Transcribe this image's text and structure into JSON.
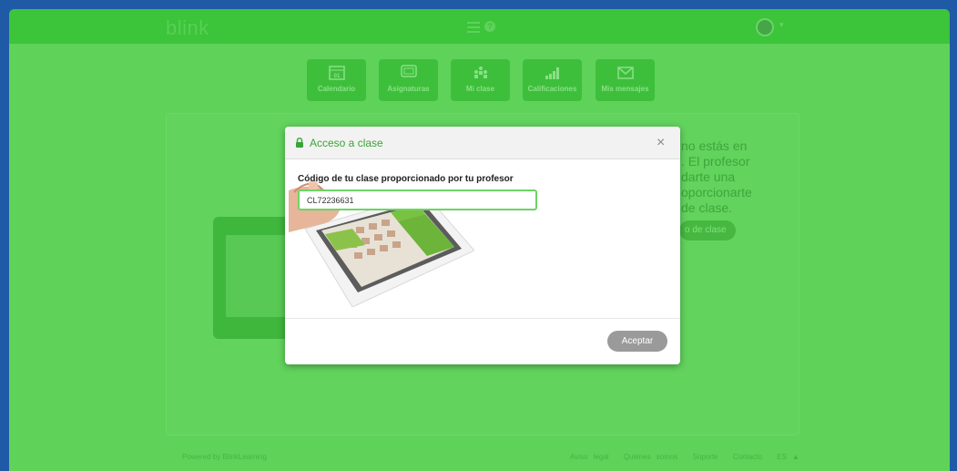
{
  "header": {
    "logo": "blink",
    "menu_icon": "hamburger-icon",
    "help_icon": "question-icon",
    "help_glyph": "?",
    "account_caret": "▾"
  },
  "nav": {
    "items": [
      {
        "label": "Calendario",
        "icon": "calendar-icon"
      },
      {
        "label": "Asignaturas",
        "icon": "monitor-icon"
      },
      {
        "label": "Mi clase",
        "icon": "people-icon"
      },
      {
        "label": "Calificaciones",
        "icon": "bar-chart-icon"
      },
      {
        "label": "Mis mensajes",
        "icon": "envelope-icon"
      }
    ]
  },
  "background": {
    "text_lines": [
      "no estás en",
      ". El profesor",
      "darte una",
      "oporcionarte",
      "de clase."
    ],
    "button_label": "o de clase"
  },
  "modal": {
    "title": "Acceso a clase",
    "close_glyph": "×",
    "field_label": "Código de tu clase proporcionado por tu profesor",
    "field_value": "CL72236631",
    "accept_label": "Aceptar"
  },
  "footer": {
    "left": "Powered by BlinkLearning",
    "links": [
      "Aviso legal",
      "Quiénes somos",
      "Soporte",
      "Contacto",
      "ES ▲"
    ]
  },
  "colors": {
    "brand_green": "#3cc43a",
    "overlay_green": "#5fd25a",
    "frame_blue": "#1f5aa6",
    "button_gray": "#9a9a9a"
  }
}
